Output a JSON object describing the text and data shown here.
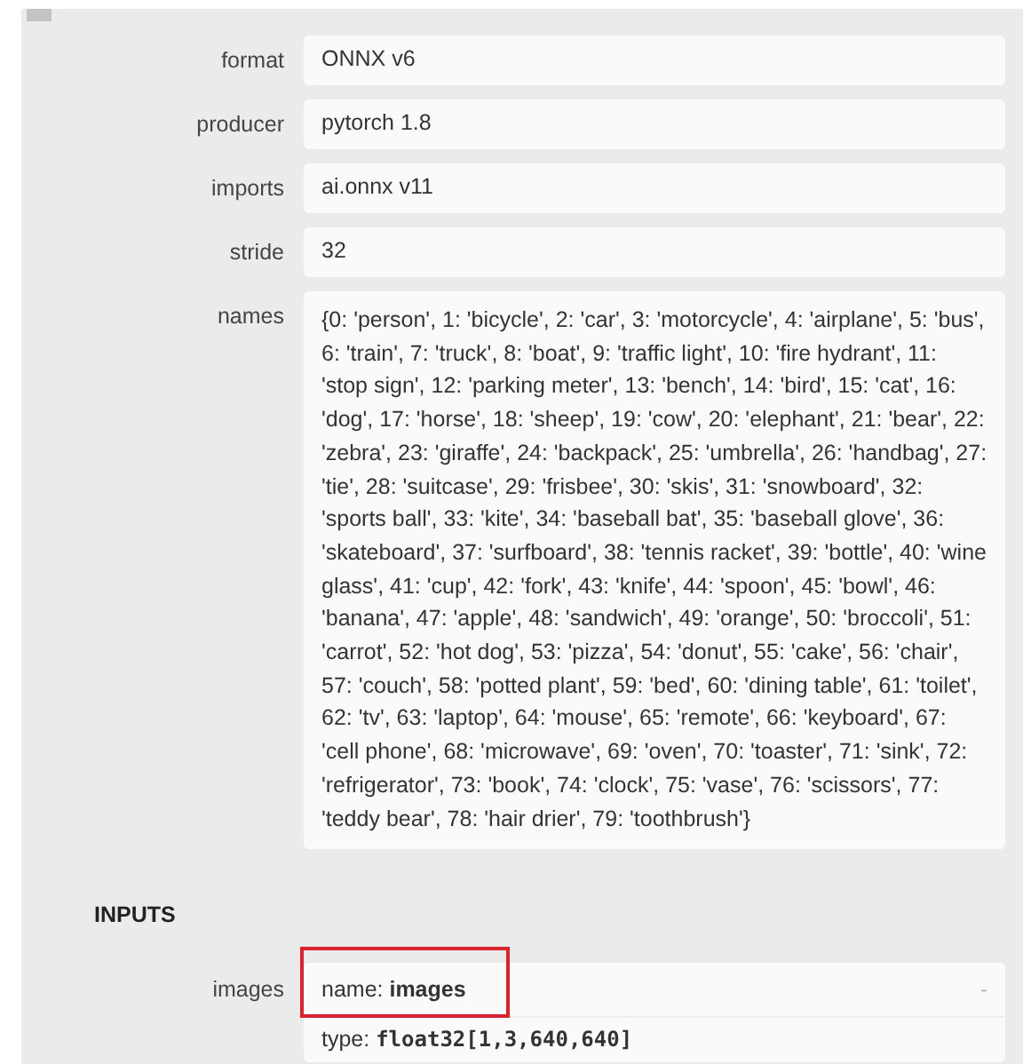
{
  "properties": [
    {
      "label": "format",
      "value": "ONNX v6"
    },
    {
      "label": "producer",
      "value": "pytorch 1.8"
    },
    {
      "label": "imports",
      "value": "ai.onnx v11"
    },
    {
      "label": "stride",
      "value": "32"
    },
    {
      "label": "names",
      "value": "{0: 'person', 1: 'bicycle', 2: 'car', 3: 'motorcycle', 4: 'airplane', 5: 'bus', 6: 'train', 7: 'truck', 8: 'boat', 9: 'traffic light', 10: 'fire hydrant', 11: 'stop sign', 12: 'parking meter', 13: 'bench', 14: 'bird', 15: 'cat', 16: 'dog', 17: 'horse', 18: 'sheep', 19: 'cow', 20: 'elephant', 21: 'bear', 22: 'zebra', 23: 'giraffe', 24: 'backpack', 25: 'umbrella', 26: 'handbag', 27: 'tie', 28: 'suitcase', 29: 'frisbee', 30: 'skis', 31: 'snowboard', 32: 'sports ball', 33: 'kite', 34: 'baseball bat', 35: 'baseball glove', 36: 'skateboard', 37: 'surfboard', 38: 'tennis racket', 39: 'bottle', 40: 'wine glass', 41: 'cup', 42: 'fork', 43: 'knife', 44: 'spoon', 45: 'bowl', 46: 'banana', 47: 'apple', 48: 'sandwich', 49: 'orange', 50: 'broccoli', 51: 'carrot', 52: 'hot dog', 53: 'pizza', 54: 'donut', 55: 'cake', 56: 'chair', 57: 'couch', 58: 'potted plant', 59: 'bed', 60: 'dining table', 61: 'toilet', 62: 'tv', 63: 'laptop', 64: 'mouse', 65: 'remote', 66: 'keyboard', 67: 'cell phone', 68: 'microwave', 69: 'oven', 70: 'toaster', 71: 'sink', 72: 'refrigerator', 73: 'book', 74: 'clock', 75: 'vase', 76: 'scissors', 77: 'teddy bear', 78: 'hair drier', 79: 'toothbrush'}"
    }
  ],
  "inputs": {
    "heading": "INPUTS",
    "items": [
      {
        "label": "images",
        "name_line": "name: **images**",
        "highlighted": true,
        "toggle": "-",
        "type_prefix": "type: ",
        "type_value": "float32[1,3,640,640]"
      }
    ]
  }
}
